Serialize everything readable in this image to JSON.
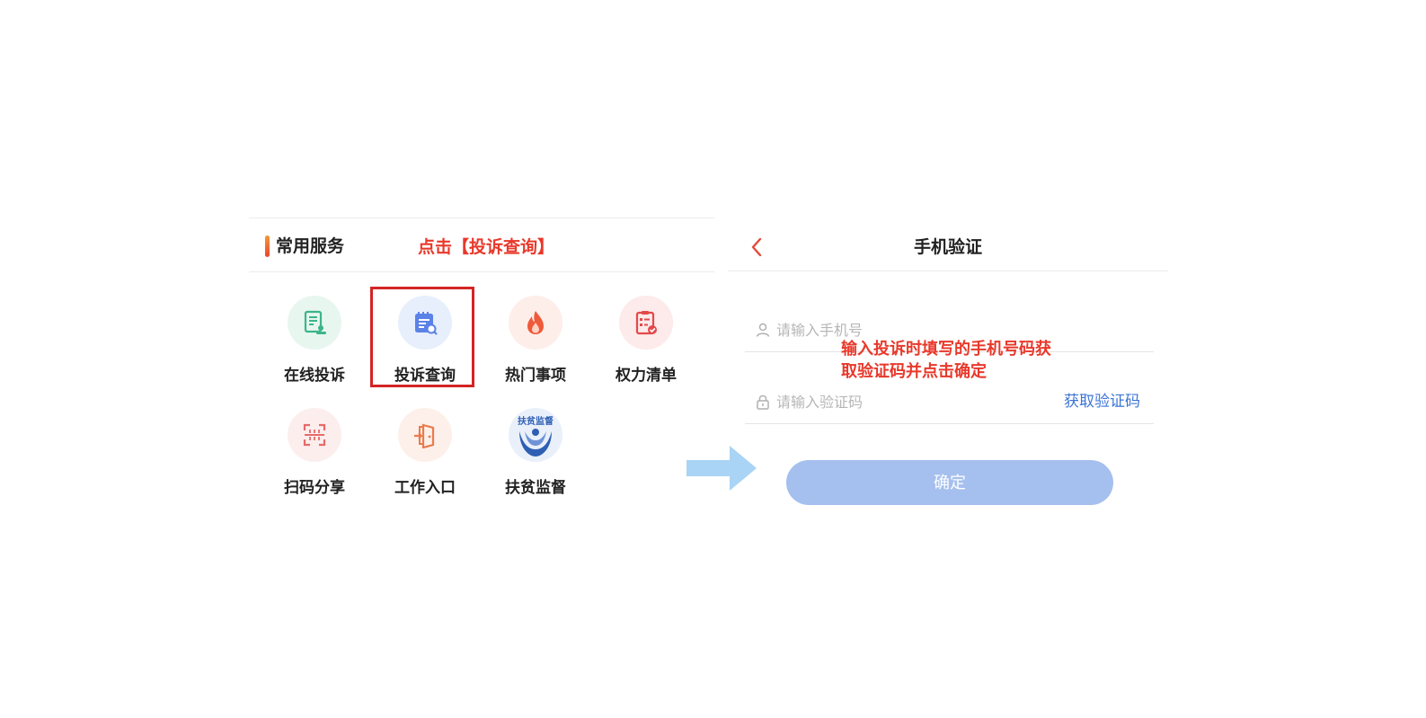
{
  "left_panel": {
    "section_title": "常用服务",
    "annotation": "点击【投诉查询】",
    "services": [
      {
        "label": "在线投诉",
        "icon": "complaint-form-icon"
      },
      {
        "label": "投诉查询",
        "icon": "complaint-query-icon"
      },
      {
        "label": "热门事项",
        "icon": "flame-icon"
      },
      {
        "label": "权力清单",
        "icon": "checklist-clipboard-icon"
      },
      {
        "label": "扫码分享",
        "icon": "scan-qr-icon"
      },
      {
        "label": "工作入口",
        "icon": "door-entry-icon"
      },
      {
        "label": "扶贫监督",
        "icon": "poverty-supervision-logo",
        "logo_text": "扶贫监督"
      }
    ],
    "highlighted_service": "投诉查询"
  },
  "right_panel": {
    "title": "手机验证",
    "phone_placeholder": "请输入手机号",
    "code_placeholder": "请输入验证码",
    "get_code_label": "获取验证码",
    "annotation": "输入投诉时填写的手机号码获取验证码并点击确定",
    "confirm_label": "确定"
  },
  "colors": {
    "accent_red": "#e8392b",
    "highlight_border": "#d42424",
    "link_blue": "#3d74d6",
    "button_disabled_blue": "#a5bfee",
    "arrow_blue": "#a9d4f5"
  }
}
